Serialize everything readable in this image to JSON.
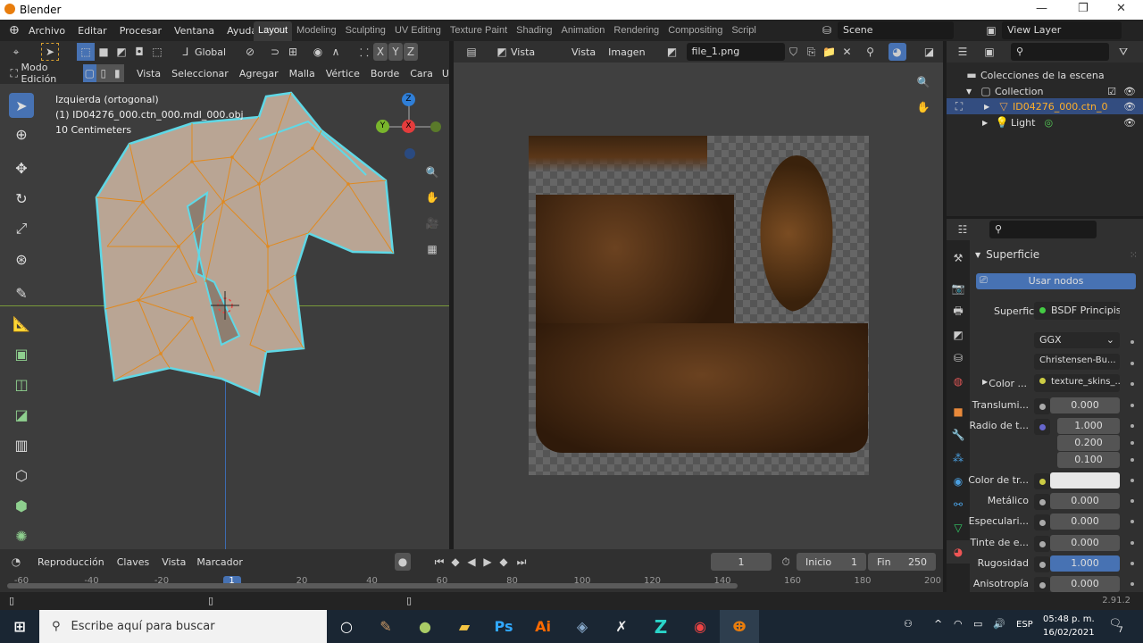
{
  "window": {
    "title": "Blender",
    "minimize": "—",
    "maximize": "❐",
    "close": "✕"
  },
  "menu": [
    "Archivo",
    "Editar",
    "Procesar",
    "Ventana",
    "Ayuda"
  ],
  "workspaces": [
    "Layout",
    "Modeling",
    "Sculpting",
    "UV Editing",
    "Texture Paint",
    "Shading",
    "Animation",
    "Rendering",
    "Compositing",
    "Scripl"
  ],
  "scene": "Scene",
  "view_layer": "View Layer",
  "view3d": {
    "transform": "Global",
    "mode": "Modo Edición",
    "menus": [
      "Vista",
      "Seleccionar",
      "Agregar",
      "Malla",
      "Vértice",
      "Borde",
      "Cara",
      "U"
    ],
    "axes": [
      "X",
      "Y",
      "Z"
    ],
    "overlay": [
      "Izquierda (ortogonal)",
      "(1) ID04276_000.ctn_000.mdl_000.obj",
      "10 Centimeters"
    ],
    "gizmo": {
      "z": "Z",
      "y": "Y",
      "x": "X"
    }
  },
  "image_editor": {
    "view": "Vista",
    "menus": [
      "Vista",
      "Imagen"
    ],
    "image": "file_1.png"
  },
  "outliner": {
    "root": "Colecciones de la escena",
    "items": [
      {
        "label": "Collection"
      },
      {
        "label": "ID04276_000.ctn_0"
      },
      {
        "label": "Light"
      }
    ]
  },
  "properties": {
    "panel": "Superficie",
    "use_nodes": "Usar nodos",
    "rows": [
      {
        "label": "Superficie",
        "value": "BSDF Principista"
      },
      {
        "label": "",
        "value": "GGX"
      },
      {
        "label": "",
        "value": "Christensen-Bu..."
      },
      {
        "label": "Color ...",
        "value": "texture_skins_..."
      },
      {
        "label": "Translumi...",
        "value": "0.000"
      },
      {
        "label": "Radio de t...",
        "value": "1.000"
      },
      {
        "label": "",
        "value": "0.200"
      },
      {
        "label": "",
        "value": "0.100"
      },
      {
        "label": "Color de tr...",
        "value": ""
      },
      {
        "label": "Metálico",
        "value": "0.000"
      },
      {
        "label": "Especulari...",
        "value": "0.000"
      },
      {
        "label": "Tinte de e...",
        "value": "0.000"
      },
      {
        "label": "Rugosidad",
        "value": "1.000"
      },
      {
        "label": "Anisotropía",
        "value": "0.000"
      }
    ]
  },
  "timeline": {
    "menus": [
      "Reproducción",
      "Claves",
      "Vista",
      "Marcador"
    ],
    "current_frame": "1",
    "start_label": "Inicio",
    "start": "1",
    "end_label": "Fin",
    "end": "250",
    "ticks": [
      "-60",
      "-40",
      "-20",
      "1",
      "20",
      "40",
      "60",
      "80",
      "100",
      "120",
      "140",
      "160",
      "180",
      "200"
    ]
  },
  "status": {
    "version": "2.91.2"
  },
  "taskbar": {
    "search_placeholder": "Escribe aquí para buscar",
    "lang": "ESP",
    "time": "05:48 p. m.",
    "date": "16/02/2021",
    "notifications": "7"
  }
}
